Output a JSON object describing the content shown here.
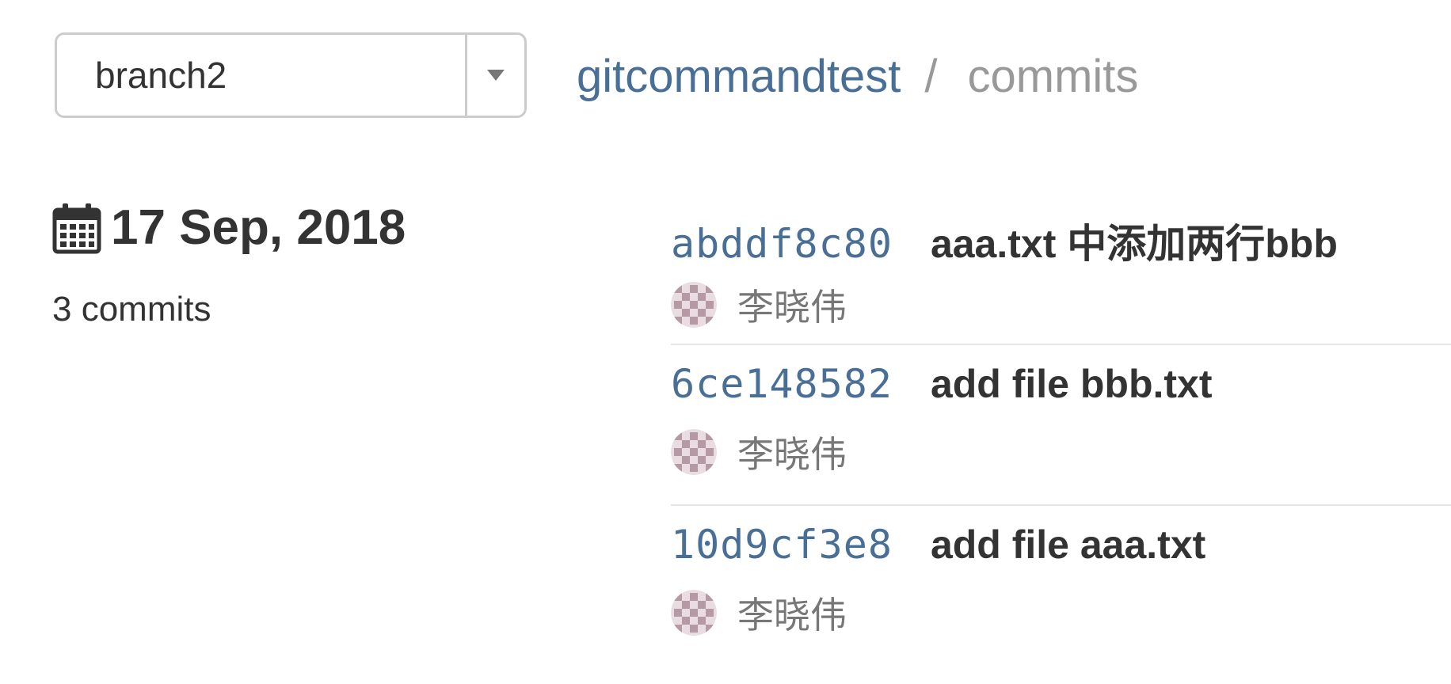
{
  "header": {
    "branch_selector": {
      "selected": "branch2"
    },
    "breadcrumb": {
      "repo": "gitcommandtest",
      "separator": "/",
      "current": "commits"
    }
  },
  "day": {
    "icon": "calendar-icon",
    "date": "17 Sep, 2018",
    "count_label": "3 commits"
  },
  "commits": [
    {
      "sha": "abddf8c80",
      "message": "aaa.txt 中添加两行bbb",
      "author": "李晓伟",
      "avatar": "identicon-avatar"
    },
    {
      "sha": "6ce148582",
      "message": "add file bbb.txt",
      "author": "李晓伟",
      "avatar": "identicon-avatar"
    },
    {
      "sha": "10d9cf3e8",
      "message": "add file aaa.txt",
      "author": "李晓伟",
      "avatar": "identicon-avatar"
    }
  ],
  "colors": {
    "link": "#4a6f96",
    "muted": "#999999",
    "text": "#333333",
    "author": "#777777",
    "border": "#cccccc",
    "avatar_pattern": "#b59aa6"
  }
}
